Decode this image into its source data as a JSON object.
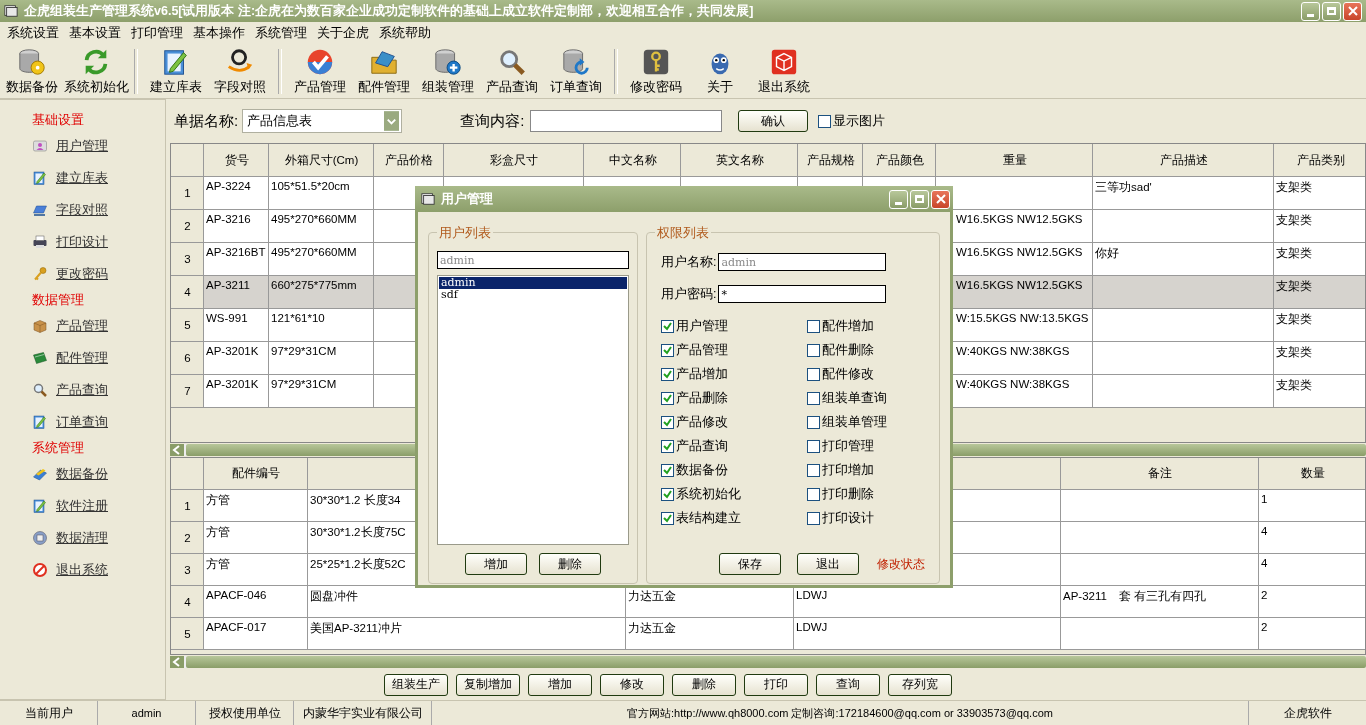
{
  "window": {
    "title": "企虎组装生产管理系统v6.5[试用版本 注:企虎在为数百家企业成功定制软件的基础上成立软件定制部，欢迎相互合作，共同发展]"
  },
  "menu": [
    "系统设置",
    "基本设置",
    "打印管理",
    "基本操作",
    "系统管理",
    "关于企虎",
    "系统帮助"
  ],
  "toolbar": [
    [
      {
        "label": "数据备份"
      },
      {
        "label": "系统初始化"
      }
    ],
    [
      {
        "label": "建立库表"
      },
      {
        "label": "字段对照"
      }
    ],
    [
      {
        "label": "产品管理"
      },
      {
        "label": "配件管理"
      },
      {
        "label": "组装管理"
      },
      {
        "label": "产品查询"
      },
      {
        "label": "订单查询"
      }
    ],
    [
      {
        "label": "修改密码"
      },
      {
        "label": "关于"
      },
      {
        "label": "退出系统"
      }
    ]
  ],
  "sidebar": {
    "groups": [
      {
        "title": "基础设置",
        "items": [
          "用户管理",
          "建立库表",
          "字段对照",
          "打印设计",
          "更改密码"
        ]
      },
      {
        "title": "数据管理",
        "items": [
          "产品管理",
          "配件管理",
          "产品查询",
          "订单查询"
        ]
      },
      {
        "title": "系统管理",
        "items": [
          "数据备份",
          "软件注册",
          "数据清理",
          "退出系统"
        ]
      }
    ]
  },
  "query": {
    "doc_label": "单据名称:",
    "doc_value": "产品信息表",
    "content_label": "查询内容:",
    "confirm": "确认",
    "show_images": {
      "label": "显示图片",
      "checked": false
    }
  },
  "product_table": {
    "columns": [
      "货号",
      "外箱尺寸(Cm)",
      "产品价格",
      "彩盒尺寸",
      "中文名称",
      "英文名称",
      "产品规格",
      "产品颜色",
      "重量",
      "产品描述",
      "产品类别"
    ],
    "rows": [
      {
        "no": "1",
        "item_no": "AP-3224",
        "carton": "105*51.5*20cm",
        "description": "三等功sad'",
        "category": "支架类",
        "selected": false
      },
      {
        "no": "2",
        "item_no": "AP-3216",
        "carton": "495*270*660MM",
        "weight": "W16.5KGS NW12.5GKS",
        "category": "支架类",
        "selected": false
      },
      {
        "no": "3",
        "item_no": "AP-3216BT",
        "carton": "495*270*660MM",
        "weight": "W16.5KGS NW12.5GKS",
        "description": "你好",
        "category": "支架类",
        "selected": false
      },
      {
        "no": "4",
        "item_no": "AP-3211",
        "carton": "660*275*775mm",
        "weight": "W16.5KGS NW12.5GKS",
        "category": "支架类",
        "selected": true
      },
      {
        "no": "5",
        "item_no": "WS-991",
        "carton": "121*61*10",
        "weight": "W:15.5KGS NW:13.5KGS",
        "category": "支架类",
        "selected": false
      },
      {
        "no": "6",
        "item_no": "AP-3201K",
        "carton": "97*29*31CM",
        "weight": "W:40KGS  NW:38KGS",
        "category": "支架类",
        "selected": false
      },
      {
        "no": "7",
        "item_no": "AP-3201K",
        "carton": "97*29*31CM",
        "weight": "W:40KGS  NW:38KGS",
        "category": "支架类",
        "selected": false
      }
    ]
  },
  "parts_table": {
    "columns": {
      "part_no": "配件编号",
      "remark": "备注",
      "quantity": "数量"
    },
    "rows": [
      {
        "no": "1",
        "part_no": "方管",
        "column_2": "30*30*1.2  长度34",
        "quantity": "1"
      },
      {
        "no": "2",
        "part_no": "方管",
        "column_2": "30*30*1.2长度75C",
        "quantity": "4"
      },
      {
        "no": "3",
        "part_no": "方管",
        "column_2": "25*25*1.2长度52C",
        "quantity": "4"
      },
      {
        "no": "4",
        "part_no": "APACF-046",
        "column_2": "圆盘冲件",
        "column_3": "力达五金",
        "column_4": "LDWJ",
        "remark": "AP-3211　套 有三孔有四孔",
        "quantity": "2"
      },
      {
        "no": "5",
        "part_no": "APACF-017",
        "column_2": "美国AP-3211冲片",
        "column_3": "力达五金",
        "column_4": "LDWJ",
        "quantity": "2"
      }
    ]
  },
  "buttons": [
    "组装生产",
    "复制增加",
    "增加",
    "修改",
    "删除",
    "打印",
    "查询",
    "存列宽"
  ],
  "status_bar": [
    "当前用户",
    "admin",
    "授权使用单位",
    "内蒙华宇实业有限公司",
    "官方网站:http://www.qh8000.com 定制咨询:172184600@qq.com or 33903573@qq.com",
    "企虎软件"
  ],
  "dialog": {
    "title": "用户管理",
    "user_list": {
      "legend": "用户列表",
      "filter_value": "admin",
      "users": [
        {
          "name": "admin",
          "selected": true
        },
        {
          "name": "sdf",
          "selected": false
        }
      ],
      "buttons": [
        "增加",
        "删除"
      ]
    },
    "permissions": {
      "legend": "权限列表",
      "name_label": "用户名称:",
      "name_value": "admin",
      "password_label": "用户密码:",
      "password_value": "*",
      "items": [
        [
          {
            "label": "用户管理",
            "checked": true
          },
          {
            "label": "配件增加",
            "checked": false
          }
        ],
        [
          {
            "label": "产品管理",
            "checked": true
          },
          {
            "label": "配件删除",
            "checked": false
          }
        ],
        [
          {
            "label": "产品增加",
            "checked": true
          },
          {
            "label": "配件修改",
            "checked": false
          }
        ],
        [
          {
            "label": "产品删除",
            "checked": true
          },
          {
            "label": "组装单查询",
            "checked": false
          }
        ],
        [
          {
            "label": "产品修改",
            "checked": true
          },
          {
            "label": "组装单管理",
            "checked": false
          }
        ],
        [
          {
            "label": "产品查询",
            "checked": true
          },
          {
            "label": "打印管理",
            "checked": false
          }
        ],
        [
          {
            "label": "数据备份",
            "checked": true
          },
          {
            "label": "打印增加",
            "checked": false
          }
        ],
        [
          {
            "label": "系统初始化",
            "checked": true
          },
          {
            "label": "打印删除",
            "checked": false
          }
        ],
        [
          {
            "label": "表结构建立",
            "checked": true
          },
          {
            "label": "打印设计",
            "checked": false
          }
        ]
      ],
      "buttons": [
        "保存",
        "退出"
      ],
      "status": "修改状态"
    }
  }
}
